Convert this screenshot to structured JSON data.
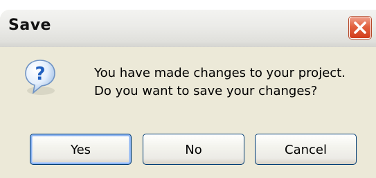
{
  "window": {
    "title": "Save"
  },
  "message": {
    "line1": "You have made changes to your project.",
    "line2": "Do you want to save your changes?"
  },
  "buttons": {
    "yes": "Yes",
    "no": "No",
    "cancel": "Cancel"
  },
  "icons": {
    "dialog_icon": "question-icon",
    "close_icon": "close-icon"
  },
  "colors": {
    "dialog_background": "#ece9d8",
    "close_button": "#d23d1c",
    "button_border": "#003c74",
    "focus_highlight": "#8cb4f2",
    "question_icon_blue": "#1f5fbf"
  }
}
